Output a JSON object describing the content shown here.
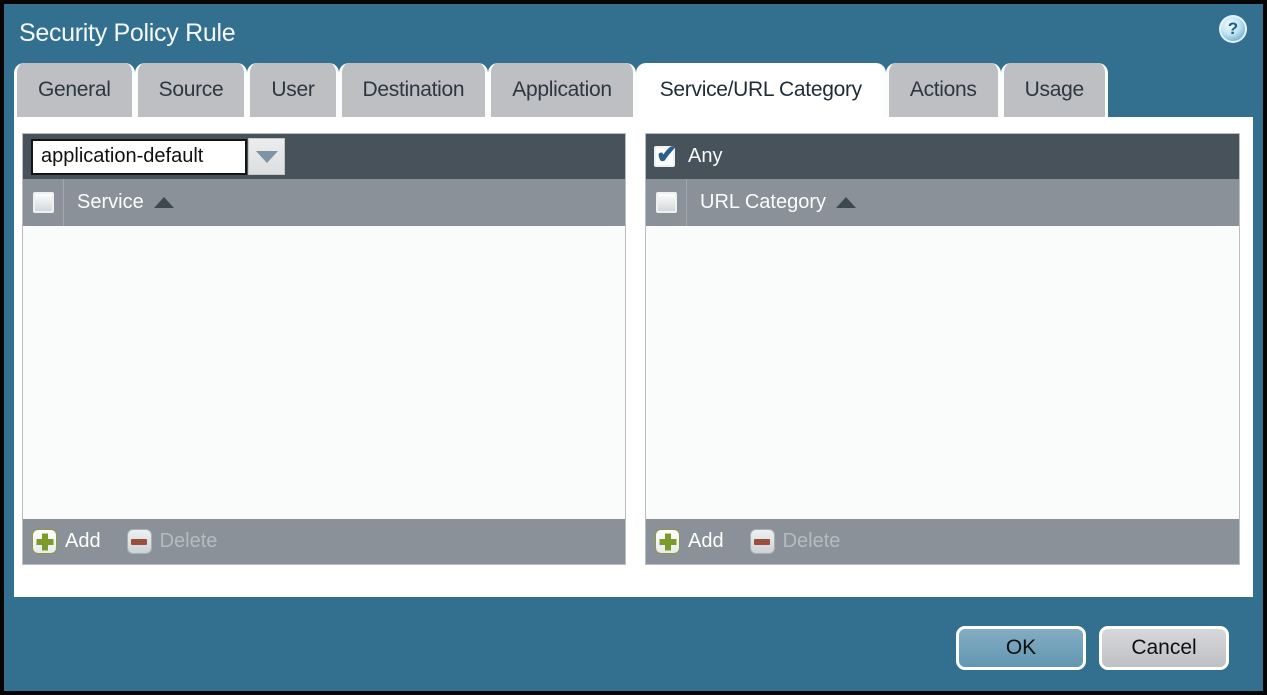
{
  "window": {
    "title": "Security Policy Rule"
  },
  "help": {
    "glyph": "?"
  },
  "tabs": [
    {
      "label": "General",
      "active": false
    },
    {
      "label": "Source",
      "active": false
    },
    {
      "label": "User",
      "active": false
    },
    {
      "label": "Destination",
      "active": false
    },
    {
      "label": "Application",
      "active": false
    },
    {
      "label": "Service/URL Category",
      "active": true
    },
    {
      "label": "Actions",
      "active": false
    },
    {
      "label": "Usage",
      "active": false
    }
  ],
  "service_panel": {
    "dropdown_value": "application-default",
    "column_header": "Service",
    "sort_order": "ascending",
    "rows": [],
    "add_label": "Add",
    "delete_label": "Delete",
    "delete_enabled": false
  },
  "url_category_panel": {
    "any_label": "Any",
    "any_checked": true,
    "column_header": "URL Category",
    "sort_order": "ascending",
    "rows": [],
    "add_label": "Add",
    "delete_label": "Delete",
    "delete_enabled": false
  },
  "actions": {
    "ok_label": "OK",
    "cancel_label": "Cancel"
  },
  "colors": {
    "dialog_background": "#336f8e",
    "titlebar_text": "#f4f8fa",
    "tab_inactive": "#bdbfc2",
    "tab_active": "#ffffff",
    "toolbar_dark": "#48525a",
    "table_header_gray": "#8a9198",
    "list_background": "#f9fcfa",
    "ok_button": "#6fa0bb",
    "cancel_button": "#c9cacd",
    "add_plus_green": "#7c9b2a",
    "delete_minus_red": "#9c4e3c",
    "checkmark_blue": "#2b5e88"
  }
}
